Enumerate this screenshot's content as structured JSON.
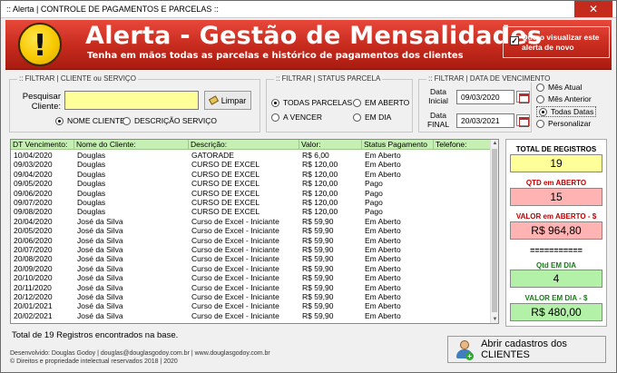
{
  "window": {
    "title": ":: Alerta | CONTROLE DE PAGAMENTOS E PARCELAS ::",
    "close_glyph": "✕"
  },
  "banner": {
    "title": "Alerta - Gestão de Mensalidades",
    "subtitle": "Tenha em mãos todas as parcelas e histórico de pagamentos dos clientes",
    "checkbox_label": "Quero visualizar este alerta de novo",
    "checkbox_checked": true
  },
  "filter_client": {
    "legend": ":: FILTRAR | CLIENTE ou SERVIÇO",
    "search_label": "Pesquisar Cliente:",
    "search_value": "",
    "clear_button": "Limpar",
    "options": [
      {
        "label": "NOME CLIENTE",
        "selected": true
      },
      {
        "label": "DESCRIÇÃO SERVIÇO",
        "selected": false
      }
    ]
  },
  "filter_status": {
    "legend": ":: FILTRAR | STATUS PARCELA",
    "options": [
      {
        "label": "TODAS PARCELAS",
        "selected": true
      },
      {
        "label": "EM ABERTO",
        "selected": false
      },
      {
        "label": "A VENCER",
        "selected": false
      },
      {
        "label": "EM DIA",
        "selected": false
      }
    ]
  },
  "filter_date": {
    "legend": ":: FILTRAR | DATA DE VENCIMENTO",
    "start_label": "Data Inicial",
    "start_value": "09/03/2020",
    "end_label": "Data FINAL",
    "end_value": "20/03/2021",
    "options": [
      {
        "label": "Mês Atual",
        "selected": false
      },
      {
        "label": "Mês Anterior",
        "selected": false
      },
      {
        "label": "Todas Datas",
        "selected": true
      },
      {
        "label": "Personalizar",
        "selected": false
      }
    ]
  },
  "table": {
    "columns": [
      "DT Vencimento:",
      "Nome do Cliente:",
      "Descrição:",
      "Valor:",
      "Status Pagamento",
      "Telefone:"
    ],
    "rows": [
      [
        "10/04/2020",
        "Douglas",
        "GATORADE",
        "R$ 6,00",
        "Em Aberto",
        ""
      ],
      [
        "09/03/2020",
        "Douglas",
        "CURSO DE EXCEL",
        "R$ 120,00",
        "Em Aberto",
        ""
      ],
      [
        "09/04/2020",
        "Douglas",
        "CURSO DE EXCEL",
        "R$ 120,00",
        "Em Aberto",
        ""
      ],
      [
        "09/05/2020",
        "Douglas",
        "CURSO DE EXCEL",
        "R$ 120,00",
        "Pago",
        ""
      ],
      [
        "09/06/2020",
        "Douglas",
        "CURSO DE EXCEL",
        "R$ 120,00",
        "Pago",
        ""
      ],
      [
        "09/07/2020",
        "Douglas",
        "CURSO DE EXCEL",
        "R$ 120,00",
        "Pago",
        ""
      ],
      [
        "09/08/2020",
        "Douglas",
        "CURSO DE EXCEL",
        "R$ 120,00",
        "Pago",
        ""
      ],
      [
        "20/04/2020",
        "José da Silva",
        "Curso de Excel - Iniciante",
        "R$ 59,90",
        "Em Aberto",
        ""
      ],
      [
        "20/05/2020",
        "José da Silva",
        "Curso de Excel - Iniciante",
        "R$ 59,90",
        "Em Aberto",
        ""
      ],
      [
        "20/06/2020",
        "José da Silva",
        "Curso de Excel - Iniciante",
        "R$ 59,90",
        "Em Aberto",
        ""
      ],
      [
        "20/07/2020",
        "José da Silva",
        "Curso de Excel - Iniciante",
        "R$ 59,90",
        "Em Aberto",
        ""
      ],
      [
        "20/08/2020",
        "José da Silva",
        "Curso de Excel - Iniciante",
        "R$ 59,90",
        "Em Aberto",
        ""
      ],
      [
        "20/09/2020",
        "José da Silva",
        "Curso de Excel - Iniciante",
        "R$ 59,90",
        "Em Aberto",
        ""
      ],
      [
        "20/10/2020",
        "José da Silva",
        "Curso de Excel - Iniciante",
        "R$ 59,90",
        "Em Aberto",
        ""
      ],
      [
        "20/11/2020",
        "José da Silva",
        "Curso de Excel - Iniciante",
        "R$ 59,90",
        "Em Aberto",
        ""
      ],
      [
        "20/12/2020",
        "José da Silva",
        "Curso de Excel - Iniciante",
        "R$ 59,90",
        "Em Aberto",
        ""
      ],
      [
        "20/01/2021",
        "José da Silva",
        "Curso de Excel - Iniciante",
        "R$ 59,90",
        "Em Aberto",
        ""
      ],
      [
        "20/02/2021",
        "José da Silva",
        "Curso de Excel - Iniciante",
        "R$ 59,90",
        "Em Aberto",
        ""
      ]
    ]
  },
  "summary_text": "Total de 19 Registros encontrados na base.",
  "stats": {
    "total_label": "TOTAL DE REGISTROS",
    "total_value": "19",
    "open_count_label": "QTD em ABERTO",
    "open_count_value": "15",
    "open_value_label": "VALOR em ABERTO - $",
    "open_value": "R$ 964,80",
    "divider": "===========",
    "ok_count_label": "Qtd EM DIA",
    "ok_count_value": "4",
    "ok_value_label": "VALOR EM DIA - $",
    "ok_value": "R$ 480,00",
    "colors": {
      "neutral": "#ffff99",
      "open": "#ffb3b3",
      "ok": "#b3f0a8",
      "open_label": "#c00000",
      "ok_label": "#1a7a1a"
    }
  },
  "footer": {
    "line1": "Desenvolvido: Douglas Godoy | douglas@douglasgodoy.com.br | www.douglasgodoy.com.br",
    "line2": "© Direitos e propriedade intelectual reservados 2018 | 2020"
  },
  "open_clients_button": "Abrir cadastros dos CLIENTES"
}
